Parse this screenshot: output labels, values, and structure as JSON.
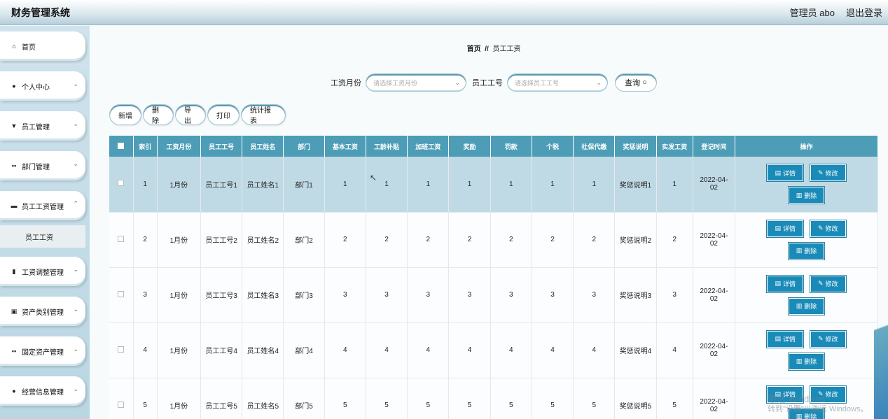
{
  "header": {
    "title": "财务管理系统",
    "user": "管理员 abo",
    "logout": "退出登录"
  },
  "sidebar": {
    "items": [
      {
        "label": "首页",
        "icon": "home-icon"
      },
      {
        "label": "个人中心",
        "icon": "user-icon"
      },
      {
        "label": "员工管理",
        "icon": "staff-icon"
      },
      {
        "label": "部门管理",
        "icon": "grid-icon"
      },
      {
        "label": "员工工资管理",
        "icon": "briefcase-icon"
      },
      {
        "label": "员工工资",
        "icon": ""
      },
      {
        "label": "工资调整管理",
        "icon": "bar-chart-icon"
      },
      {
        "label": "资产类别管理",
        "icon": "clipboard-icon"
      },
      {
        "label": "固定资产管理",
        "icon": "grid-icon"
      },
      {
        "label": "经营信息管理",
        "icon": "bulb-icon"
      }
    ]
  },
  "breadcrumb": {
    "home": "首页",
    "sep": "//",
    "current": "员工工资"
  },
  "search": {
    "month_label": "工资月份",
    "month_placeholder": "请选择工资月份",
    "emp_label": "员工工号",
    "emp_placeholder": "请选择员工工号",
    "query_label": "查询"
  },
  "toolbar": {
    "add": "新增",
    "delete": "删除",
    "export": "导出",
    "print": "打印",
    "stats": "统计报表"
  },
  "table": {
    "headers": [
      "索引",
      "工资月份",
      "员工工号",
      "员工姓名",
      "部门",
      "基本工资",
      "工龄补贴",
      "加班工资",
      "奖励",
      "罚款",
      "个税",
      "社保代缴",
      "奖惩说明",
      "实发工资",
      "登记时间",
      "操作"
    ],
    "rows": [
      [
        "1",
        "1月份",
        "员工工号1",
        "员工姓名1",
        "部门1",
        "1",
        "1",
        "1",
        "1",
        "1",
        "1",
        "1",
        "奖惩说明1",
        "1",
        "2022-04-02"
      ],
      [
        "2",
        "1月份",
        "员工工号2",
        "员工姓名2",
        "部门2",
        "2",
        "2",
        "2",
        "2",
        "2",
        "2",
        "2",
        "奖惩说明2",
        "2",
        "2022-04-02"
      ],
      [
        "3",
        "1月份",
        "员工工号3",
        "员工姓名3",
        "部门3",
        "3",
        "3",
        "3",
        "3",
        "3",
        "3",
        "3",
        "奖惩说明3",
        "3",
        "2022-04-02"
      ],
      [
        "4",
        "1月份",
        "员工工号4",
        "员工姓名4",
        "部门4",
        "4",
        "4",
        "4",
        "4",
        "4",
        "4",
        "4",
        "奖惩说明4",
        "4",
        "2022-04-02"
      ],
      [
        "5",
        "1月份",
        "员工工号5",
        "员工姓名5",
        "部门5",
        "5",
        "5",
        "5",
        "5",
        "5",
        "5",
        "5",
        "奖惩说明5",
        "5",
        "2022-04-02"
      ]
    ],
    "ops": {
      "detail": "详情",
      "edit": "修改",
      "delete": "删除"
    }
  },
  "watermark": {
    "line1": "激活 Windows",
    "line2": "转到\"设置\"以激活 Windows。"
  }
}
